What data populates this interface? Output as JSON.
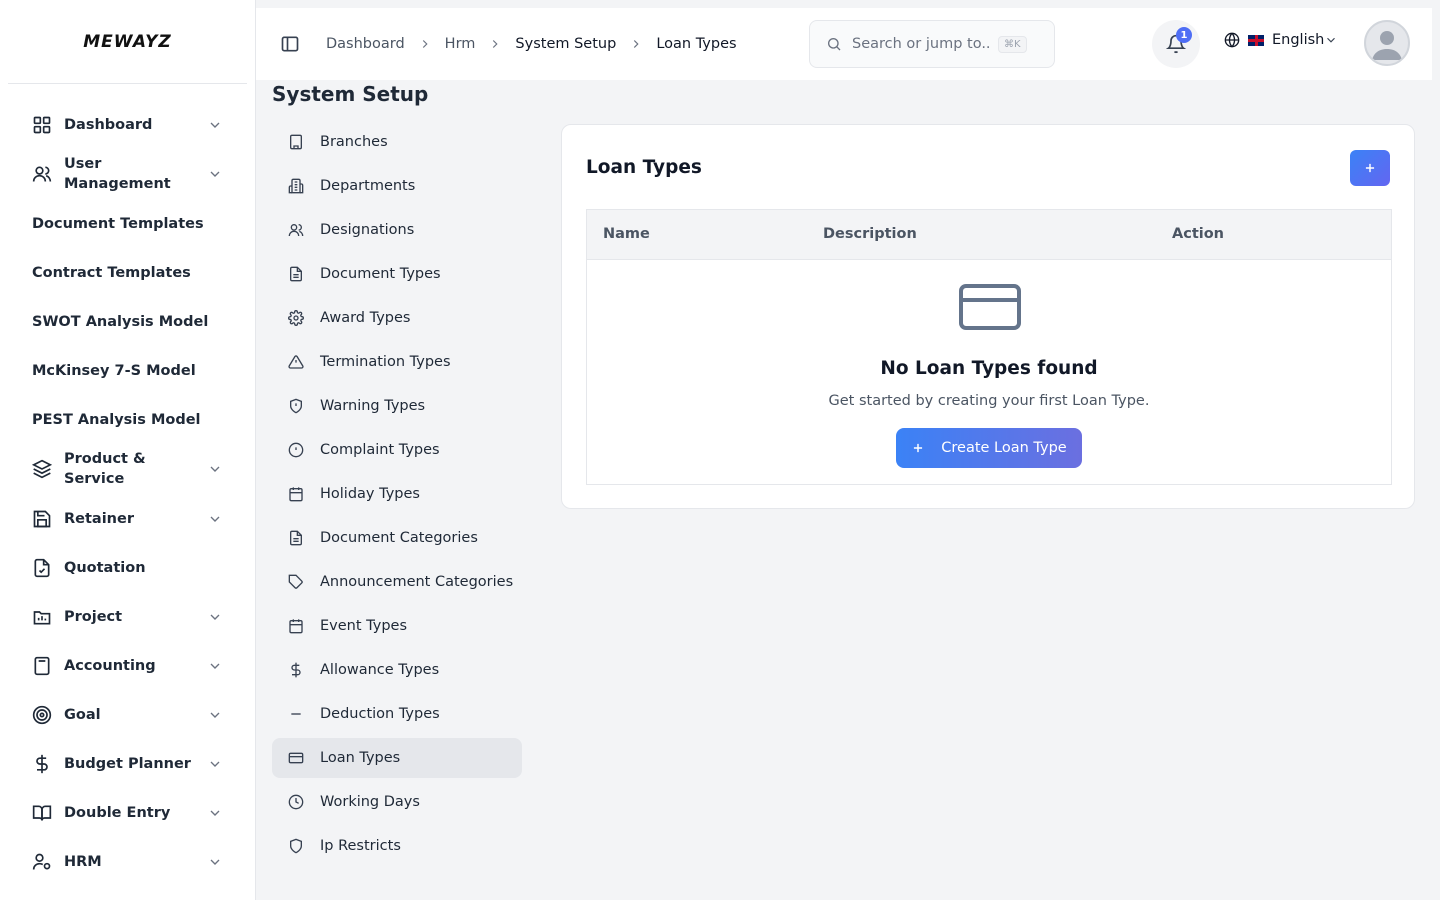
{
  "app": {
    "logo_text": "MEWAYZ"
  },
  "sidebar": {
    "items": [
      {
        "label": "Dashboard",
        "icon": "grid-icon",
        "has_children": true
      },
      {
        "label": "User Management",
        "icon": "users-icon",
        "has_children": true
      },
      {
        "label": "Document Templates",
        "has_children": false
      },
      {
        "label": "Contract Templates",
        "has_children": false
      },
      {
        "label": "SWOT Analysis Model",
        "has_children": false
      },
      {
        "label": "McKinsey 7-S Model",
        "has_children": false
      },
      {
        "label": "PEST Analysis Model",
        "has_children": false
      },
      {
        "label": "Product & Service",
        "icon": "layers-icon",
        "has_children": true
      },
      {
        "label": "Retainer",
        "icon": "save-icon",
        "has_children": true
      },
      {
        "label": "Quotation",
        "icon": "file-check-icon",
        "has_children": false
      },
      {
        "label": "Project",
        "icon": "folder-icon",
        "has_children": true
      },
      {
        "label": "Accounting",
        "icon": "calculator-icon",
        "has_children": true
      },
      {
        "label": "Goal",
        "icon": "target-icon",
        "has_children": true
      },
      {
        "label": "Budget Planner",
        "icon": "dollar-icon",
        "has_children": true
      },
      {
        "label": "Double Entry",
        "icon": "book-icon",
        "has_children": true
      },
      {
        "label": "HRM",
        "icon": "user-cog-icon",
        "has_children": true
      }
    ]
  },
  "header": {
    "breadcrumbs": [
      "Dashboard",
      "Hrm",
      "System Setup",
      "Loan Types"
    ],
    "search_placeholder": "Search or jump to...",
    "search_shortcut": "⌘K",
    "notification_count": "1",
    "language": "English"
  },
  "page": {
    "title": "System Setup",
    "setup_menu": [
      {
        "label": "Branches",
        "icon": "building-icon"
      },
      {
        "label": "Departments",
        "icon": "office-icon"
      },
      {
        "label": "Designations",
        "icon": "users-icon"
      },
      {
        "label": "Document Types",
        "icon": "document-icon"
      },
      {
        "label": "Award Types",
        "icon": "gear-icon"
      },
      {
        "label": "Termination Types",
        "icon": "warning-triangle-icon"
      },
      {
        "label": "Warning Types",
        "icon": "shield-alert-icon"
      },
      {
        "label": "Complaint Types",
        "icon": "alert-circle-icon"
      },
      {
        "label": "Holiday Types",
        "icon": "calendar-icon"
      },
      {
        "label": "Document Categories",
        "icon": "document-icon"
      },
      {
        "label": "Announcement Categories",
        "icon": "tag-icon"
      },
      {
        "label": "Event Types",
        "icon": "calendar-icon"
      },
      {
        "label": "Allowance Types",
        "icon": "dollar-icon"
      },
      {
        "label": "Deduction Types",
        "icon": "minus-icon"
      },
      {
        "label": "Loan Types",
        "icon": "credit-card-icon",
        "active": true
      },
      {
        "label": "Working Days",
        "icon": "clock-icon"
      },
      {
        "label": "Ip Restricts",
        "icon": "shield-icon"
      }
    ]
  },
  "card": {
    "title": "Loan Types",
    "table_headers": {
      "name": "Name",
      "description": "Description",
      "action": "Action"
    },
    "empty_title": "No Loan Types found",
    "empty_subtitle": "Get started by creating your first Loan Type.",
    "create_label": "Create Loan Type"
  },
  "colors": {
    "accent": "#3b82f6",
    "accent_end": "#6366f1"
  }
}
